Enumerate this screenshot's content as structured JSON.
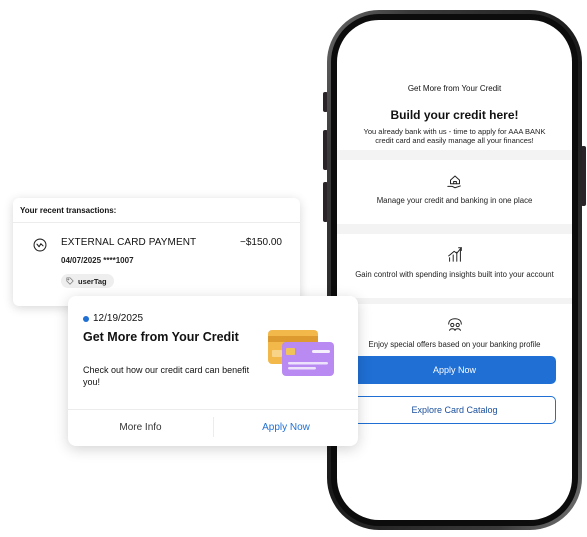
{
  "phone": {
    "eyebrow": "Get More from Your Credit",
    "title": "Build your credit here!",
    "description": "You already bank with us - time to apply for AAA BANK credit card and easily manage all your finances!",
    "features": [
      {
        "icon": "hand-house-icon",
        "text": "Manage your credit and banking in one place"
      },
      {
        "icon": "growth-chart-icon",
        "text": "Gain control with spending insights built into your account"
      },
      {
        "icon": "people-offer-icon",
        "text": "Enjoy special offers based on your banking profile"
      }
    ],
    "apply_label": "Apply Now",
    "catalog_label": "Explore Card Catalog"
  },
  "transactions": {
    "header": "Your recent transactions:",
    "item": {
      "title": "EXTERNAL CARD PAYMENT",
      "amount": "−$150.00",
      "meta": "04/07/2025 ****1007",
      "tag": "userTag"
    }
  },
  "promo": {
    "date": "12/19/2025",
    "title": "Get More from Your Credit",
    "body": "Check out how our credit card can benefit you!",
    "more_label": "More Info",
    "apply_label": "Apply Now"
  },
  "colors": {
    "accent": "#1f6fd4",
    "card_gold": "#f2b84a",
    "card_purple": "#b98af2"
  }
}
